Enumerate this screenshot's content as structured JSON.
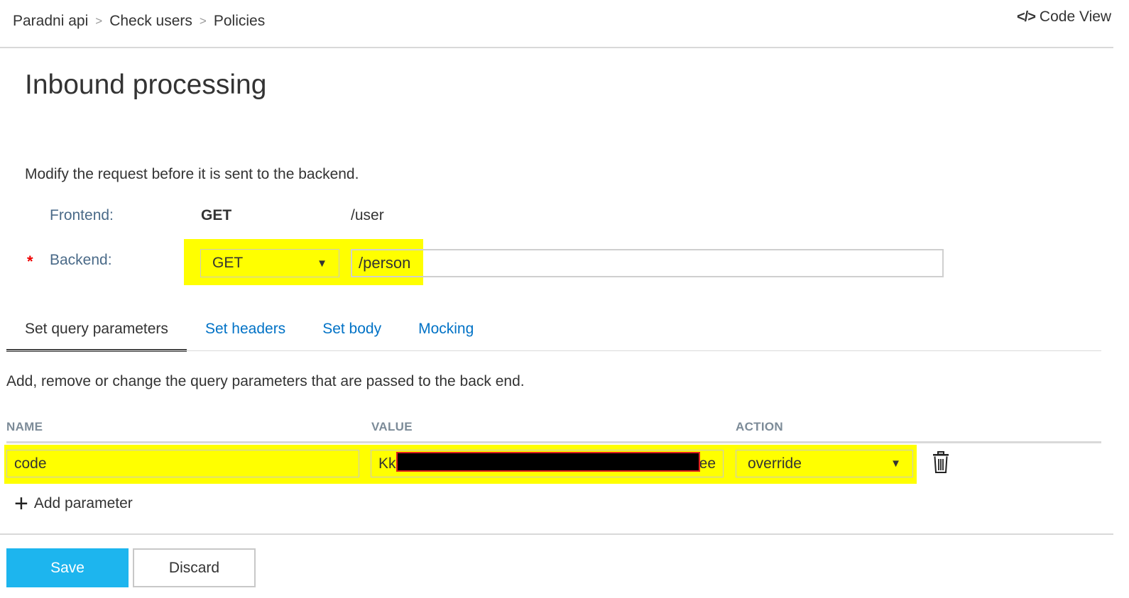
{
  "breadcrumb": [
    "Paradni api",
    "Check users",
    "Policies"
  ],
  "breadcrumb_separator": ">",
  "code_view": {
    "icon": "code-icon",
    "label": "Code View"
  },
  "title": "Inbound processing",
  "description": "Modify the request before it is sent to the backend.",
  "frontend": {
    "label": "Frontend:",
    "method": "GET",
    "path": "/user"
  },
  "backend": {
    "required_marker": "*",
    "label": "Backend:",
    "method": "GET",
    "path": "/person"
  },
  "tabs": [
    {
      "label": "Set query parameters",
      "active": true
    },
    {
      "label": "Set headers",
      "active": false
    },
    {
      "label": "Set body",
      "active": false
    },
    {
      "label": "Mocking",
      "active": false
    }
  ],
  "tab_description": "Add, remove or change the query parameters that are passed to the back end.",
  "table": {
    "columns": [
      "NAME",
      "VALUE",
      "ACTION"
    ],
    "rows": [
      {
        "name": "code",
        "value_prefix": "Kk",
        "value_suffix": "ee",
        "value_redacted": true,
        "action": "override"
      }
    ]
  },
  "add_parameter": "Add parameter",
  "buttons": {
    "save": "Save",
    "discard": "Discard"
  },
  "colors": {
    "highlight": "#ffff00",
    "link": "#0072c6",
    "save_button": "#1db5ee",
    "redaction_border": "#e0201f"
  }
}
